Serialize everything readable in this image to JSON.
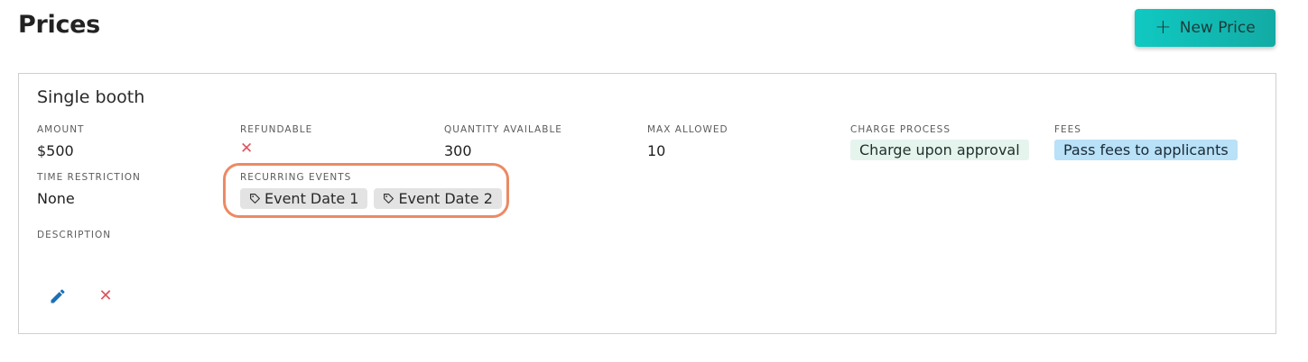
{
  "page": {
    "title": "Prices"
  },
  "toolbar": {
    "new_price_icon": "plus-icon",
    "new_price_label": "New Price"
  },
  "price_card": {
    "title": "Single booth",
    "fields": {
      "amount": {
        "label": "AMOUNT",
        "value": "$500"
      },
      "refundable": {
        "label": "REFUNDABLE",
        "icon": "close-icon",
        "color": "#e0545f"
      },
      "quantity_available": {
        "label": "QUANTITY AVAILABLE",
        "value": "300"
      },
      "max_allowed": {
        "label": "MAX ALLOWED",
        "value": "10"
      },
      "charge_process": {
        "label": "CHARGE PROCESS",
        "value": "Charge upon approval",
        "chip_color": "#e6f4ee"
      },
      "fees": {
        "label": "FEES",
        "value": "Pass fees to applicants",
        "chip_color": "#b9e1f7"
      },
      "time_restriction": {
        "label": "TIME RESTRICTION",
        "value": "None"
      },
      "recurring_events": {
        "label": "RECURRING EVENTS",
        "tags": [
          {
            "icon": "tag-icon",
            "label": "Event Date 1"
          },
          {
            "icon": "tag-icon",
            "label": "Event Date 2"
          }
        ],
        "highlight_color": "#ec8a63"
      },
      "description": {
        "label": "DESCRIPTION",
        "value": ""
      }
    },
    "actions": {
      "edit": {
        "icon": "pencil-icon",
        "color": "#1a6fb5"
      },
      "delete": {
        "icon": "close-icon",
        "color": "#e0545f"
      }
    }
  },
  "colors": {
    "accent": "#10c9c2"
  }
}
